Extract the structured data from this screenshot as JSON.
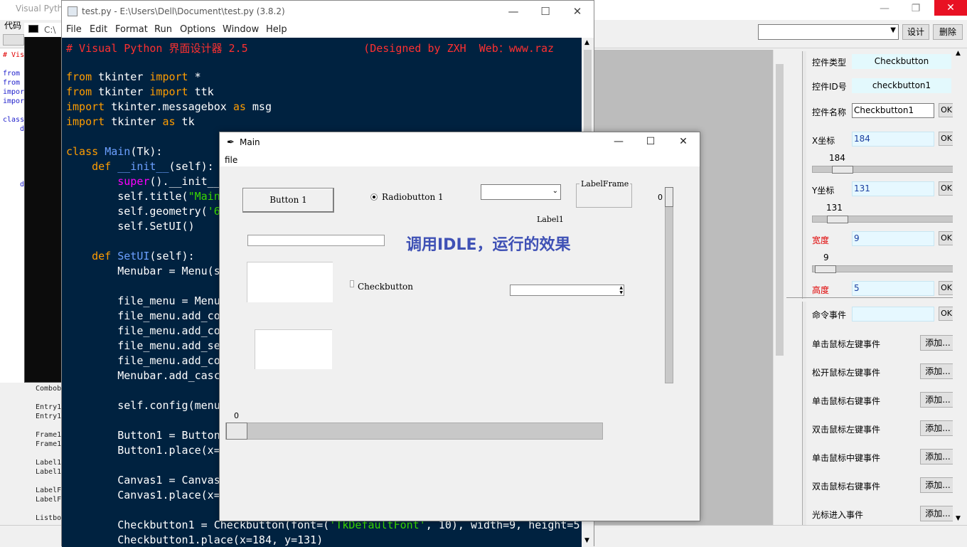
{
  "bg_app": {
    "title": "Visual Pyth",
    "menu_label": "代码",
    "combo_value": "",
    "design_button": "设计",
    "delete_button": "删除",
    "code_snippets": [
      "# Vis",
      "from",
      "from",
      "impor",
      "impor",
      "class",
      "d",
      "d"
    ],
    "widget_list": [
      "Combob",
      "Entry1",
      "Entry1",
      "Frame1",
      "Frame1",
      "Label1",
      "Label1",
      "LabelF",
      "LabelF",
      "Listbo"
    ]
  },
  "properties": {
    "rows": [
      {
        "label": "控件类型",
        "value": "Checkbutton",
        "style": "center"
      },
      {
        "label": "控件ID号",
        "value": "checkbutton1",
        "style": "center"
      },
      {
        "label": "控件名称",
        "value": "Checkbutton1",
        "style": "entry",
        "ok": "OK"
      },
      {
        "label": "X坐标",
        "value": "184",
        "style": "blue",
        "ok": "OK"
      },
      {
        "label": "Y坐标",
        "value": "131",
        "style": "blue",
        "ok": "OK"
      },
      {
        "label": "宽度",
        "value": "9",
        "style": "blue",
        "ok": "OK",
        "red": true
      },
      {
        "label": "高度",
        "value": "5",
        "style": "blue",
        "ok": "OK",
        "red": true
      }
    ],
    "sliders": [
      {
        "value": "184",
        "fraction": 0.16
      },
      {
        "value": "131",
        "fraction": 0.12
      },
      {
        "value": "9",
        "fraction": 0.02
      }
    ],
    "command_event": {
      "label": "命令事件",
      "value": "",
      "ok": "OK"
    },
    "events": [
      {
        "label": "单击鼠标左键事件",
        "button": "添加..."
      },
      {
        "label": "松开鼠标左键事件",
        "button": "添加..."
      },
      {
        "label": "单击鼠标右键事件",
        "button": "添加..."
      },
      {
        "label": "双击鼠标左键事件",
        "button": "添加..."
      },
      {
        "label": "单击鼠标中键事件",
        "button": "添加..."
      },
      {
        "label": "双击鼠标右键事件",
        "button": "添加..."
      },
      {
        "label": "光标进入事件",
        "button": "添加..."
      }
    ]
  },
  "console": {
    "title": "C:\\"
  },
  "idle": {
    "title": "test.py - E:\\Users\\Dell\\Document\\test.py (3.8.2)",
    "menus": [
      "File",
      "Edit",
      "Format",
      "Run",
      "Options",
      "Window",
      "Help"
    ],
    "colors": {
      "background": "#002240",
      "keyword": "#ff9d00",
      "string": "#3ad900",
      "comment": "#ff3030"
    }
  },
  "main_window": {
    "title": "Main",
    "menu_file": "file",
    "button1": "Button 1",
    "radiobutton1": "Radiobutton 1",
    "combobox_value": "",
    "labelframe": "LabelFrame",
    "label1": "Label1",
    "caption": "调用IDLE，运行的效果",
    "checkbutton": "Checkbutton",
    "vscale_value": "0",
    "hscale_value": "0",
    "caption_color": "#3f51b5"
  }
}
